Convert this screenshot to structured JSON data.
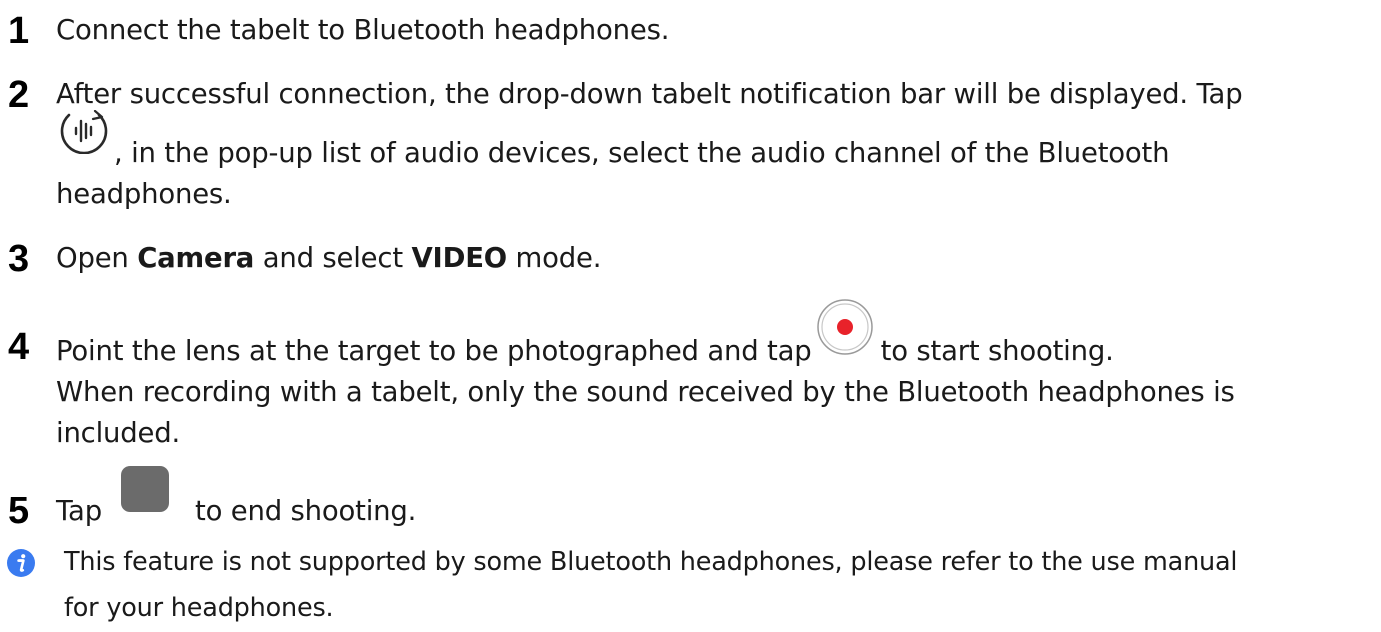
{
  "steps": [
    {
      "number": "1",
      "text": "Connect the tabelt to Bluetooth headphones."
    },
    {
      "number": "2",
      "line1": "After successful connection, the drop-down tabelt notification bar will be displayed. Tap",
      "line2": ", in the pop-up list of audio devices, select the audio channel of the Bluetooth",
      "line3": "headphones.",
      "icon": "audio-output-icon"
    },
    {
      "number": "3",
      "before": "Open ",
      "bold1": "Camera",
      "middle": " and select ",
      "bold2": "VIDEO",
      "after": " mode."
    },
    {
      "number": "4",
      "before": "Point the lens at the target to be photographed and tap ",
      "after": " to start shooting.",
      "line2": "When recording with a tabelt, only the sound received by the Bluetooth headphones is",
      "line3": "included.",
      "icon": "record-button-icon"
    },
    {
      "number": "5",
      "before": "Tap ",
      "after": " to end shooting.",
      "icon": "stop-button-icon"
    }
  ],
  "note": {
    "icon": "info-icon",
    "line1": "This feature is not supported by some Bluetooth headphones, please refer to the use manual",
    "line2": "for your headphones."
  },
  "colors": {
    "info_icon": "#3a7bf0",
    "record_dot": "#e8222a",
    "stop_square": "#6b6b6b"
  }
}
